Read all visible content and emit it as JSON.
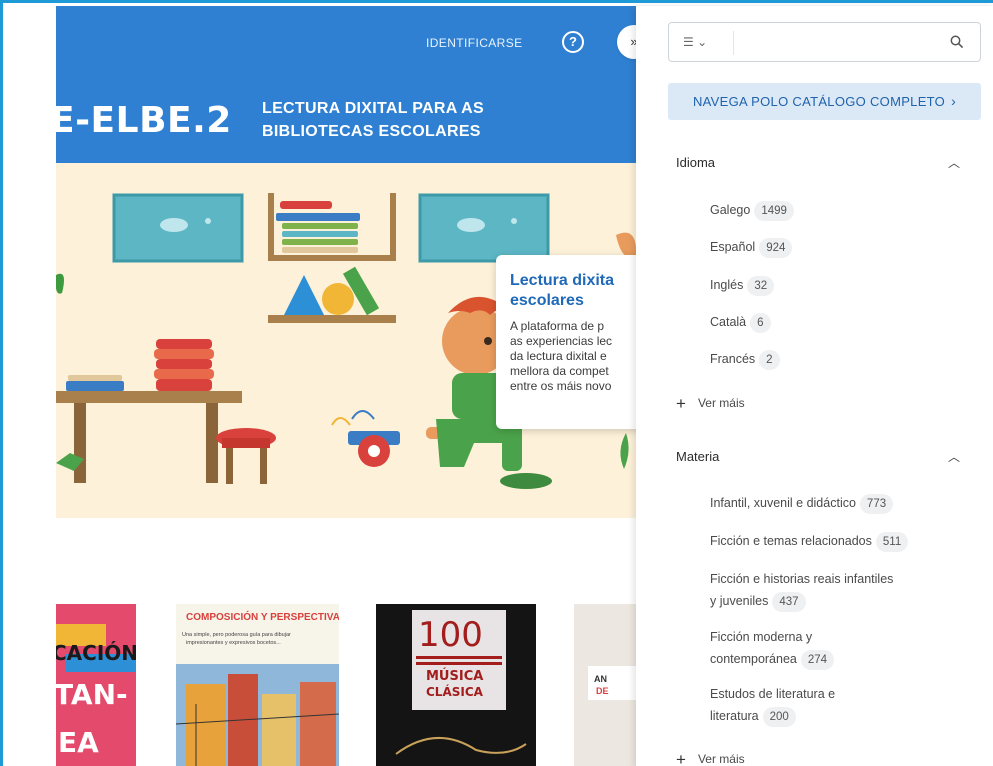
{
  "header": {
    "login_label": "IDENTIFICARSE",
    "help_icon": "help-circle-icon",
    "brand": "E-ELBE.2",
    "subtitle_line1": "LECTURA DIXITAL PARA AS",
    "subtitle_line2": "BIBLIOTECAS ESCOLARES",
    "background_color": "#2f80d2"
  },
  "hero": {
    "card_title_line1": "Lectura dixita",
    "card_title_line2": "escolares",
    "card_text": [
      "A plataforma de p",
      "as experiencias lec",
      "da lectura dixital e",
      "mellora da compet",
      "entre os máis novo"
    ]
  },
  "books": [
    {
      "title_lines": [
        "CACIÓN",
        "TAN-",
        "EA"
      ]
    },
    {
      "title_lines": [
        "COMPOSICIÓN Y PERSPECTIVA",
        "Una simple, pero poderosa guía para dibujar",
        "impresionantes y expresivos bocetos..."
      ]
    },
    {
      "title_lines": [
        "100",
        "MÚSICA",
        "CLÁSICA"
      ]
    },
    {
      "title_lines": [
        "AN",
        "DE"
      ]
    }
  ],
  "panel": {
    "collapse_glyph": "»",
    "search_filter_icon": "list-icon",
    "search_placeholder": "",
    "catalog_button": "NAVEGA POLO CATÁLOGO COMPLETO",
    "catalog_chevron": "›",
    "sections": [
      {
        "title": "Idioma",
        "facets": [
          {
            "label": "Galego",
            "count": "1499"
          },
          {
            "label": "Español",
            "count": "924"
          },
          {
            "label": "Inglés",
            "count": "32"
          },
          {
            "label": "Català",
            "count": "6"
          },
          {
            "label": "Francés",
            "count": "2"
          }
        ],
        "more_label": "Ver máis"
      },
      {
        "title": "Materia",
        "facets": [
          {
            "label": "Infantil, xuvenil e didáctico",
            "count": "773"
          },
          {
            "label": "Ficción e temas relacionados",
            "count": "511"
          },
          {
            "label_line1": "Ficción e historias reais infantiles",
            "label_line2": "y juveniles",
            "count": "437"
          },
          {
            "label_line1": "Ficción moderna y",
            "label_line2": "contemporánea",
            "count": "274"
          },
          {
            "label_line1": "Estudos de literatura e",
            "label_line2": "literatura",
            "count": "200"
          }
        ],
        "more_label": "Ver máis"
      }
    ]
  },
  "colors": {
    "accent": "#2f80d2",
    "frame": "#1e9bd7",
    "catalog_bg": "#dbe9f7",
    "catalog_text": "#1f62ad"
  }
}
